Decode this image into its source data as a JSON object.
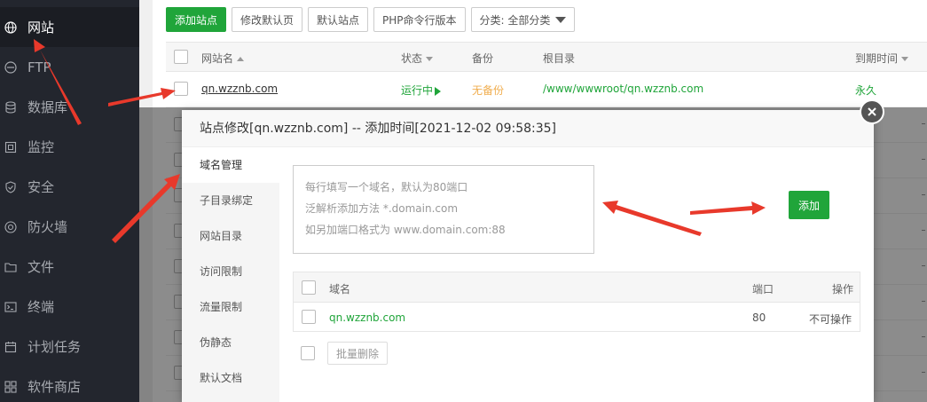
{
  "sidebar": {
    "items": [
      {
        "label": "网站",
        "icon": "globe-icon",
        "active": true
      },
      {
        "label": "FTP",
        "icon": "ftp-icon"
      },
      {
        "label": "数据库",
        "icon": "database-icon"
      },
      {
        "label": "监控",
        "icon": "monitor-icon"
      },
      {
        "label": "安全",
        "icon": "shield-icon"
      },
      {
        "label": "防火墙",
        "icon": "firewall-icon"
      },
      {
        "label": "文件",
        "icon": "folder-icon"
      },
      {
        "label": "终端",
        "icon": "terminal-icon"
      },
      {
        "label": "计划任务",
        "icon": "calendar-icon"
      },
      {
        "label": "软件商店",
        "icon": "apps-grid-icon"
      }
    ]
  },
  "toolbar": {
    "add_site": "添加站点",
    "modify_default_page": "修改默认页",
    "default_site": "默认站点",
    "php_cli_version": "PHP命令行版本",
    "category": "分类: 全部分类"
  },
  "table": {
    "headers": {
      "site_name": "网站名",
      "status": "状态",
      "backup": "备份",
      "root_dir": "根目录",
      "expire": "到期时间"
    },
    "rows": [
      {
        "site_name": "qn.wzznb.com",
        "status": "运行中",
        "backup": "无备份",
        "root_dir": "/www/wwwroot/qn.wzznb.com",
        "expire": "永久"
      }
    ]
  },
  "modal": {
    "title": "站点修改[qn.wzznb.com] -- 添加时间[2021-12-02 09:58:35]",
    "tabs": [
      "域名管理",
      "子目录绑定",
      "网站目录",
      "访问限制",
      "流量限制",
      "伪静态",
      "默认文档"
    ],
    "active_tab": "域名管理",
    "domain_input": {
      "placeholder_lines": [
        "每行填写一个域名，默认为80端口",
        "泛解析添加方法 *.domain.com",
        "如另加端口格式为 www.domain.com:88"
      ]
    },
    "add_button": "添加",
    "domain_table": {
      "headers": {
        "domain": "域名",
        "port": "端口",
        "action": "操作"
      },
      "rows": [
        {
          "domain": "qn.wzznb.com",
          "port": "80",
          "action": "不可操作"
        }
      ]
    },
    "batch_delete": "批量删除"
  },
  "colors": {
    "accent_green": "#20a53a",
    "annotation_red": "#e8392b",
    "sidebar_bg": "#23262e"
  }
}
